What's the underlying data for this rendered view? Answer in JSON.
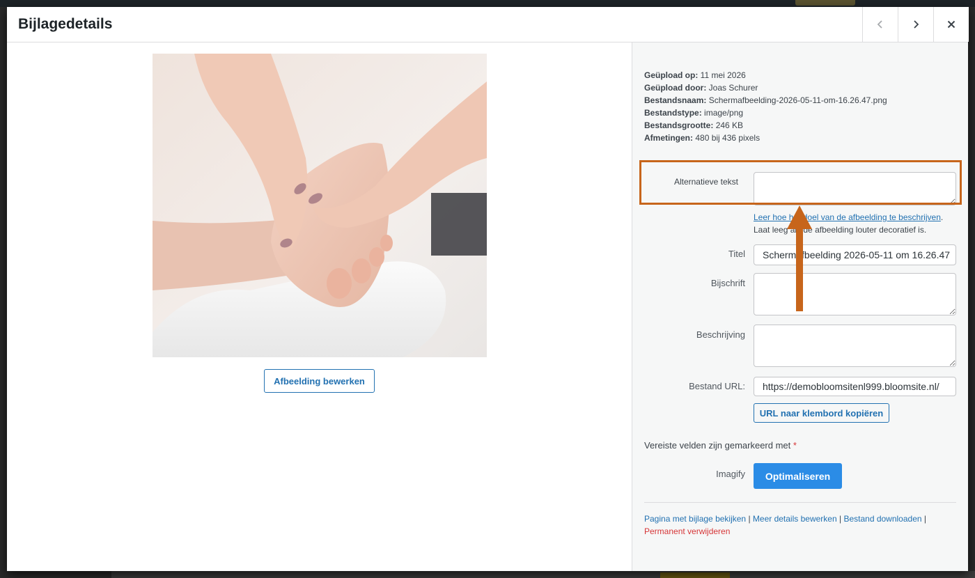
{
  "modal": {
    "title": "Bijlagedetails"
  },
  "image": {
    "alt": "Voetmassage"
  },
  "buttons": {
    "edit_image": "Afbeelding bewerken",
    "copy_url": "URL naar klembord kopiëren",
    "optimize": "Optimaliseren"
  },
  "file_info": {
    "uploaded_on_label": "Geüpload op:",
    "uploaded_on": "11 mei 2026",
    "uploaded_by_label": "Geüpload door:",
    "uploaded_by": "Joas Schurer",
    "filename_label": "Bestandsnaam:",
    "filename": "Schermafbeelding-2026-05-11-om-16.26.47.png",
    "filetype_label": "Bestandstype:",
    "filetype": "image/png",
    "filesize_label": "Bestandsgrootte:",
    "filesize": "246 KB",
    "dimensions_label": "Afmetingen:",
    "dimensions": "480 bij 436 pixels"
  },
  "fields": {
    "alt_label": "Alternatieve tekst",
    "alt_value": "",
    "alt_help_link": "Leer hoe het doel van de afbeelding te beschrijven",
    "alt_help_text": "Laat leeg als de afbeelding louter decoratief is.",
    "title_label": "Titel",
    "title_value": "Schermafbeelding 2026-05-11 om 16.26.47",
    "caption_label": "Bijschrift",
    "caption_value": "",
    "description_label": "Beschrijving",
    "description_value": "",
    "url_label": "Bestand URL:",
    "url_value": "https://demobloomsitenl999.bloomsite.nl/"
  },
  "required_note": {
    "text": "Vereiste velden zijn gemarkeerd met",
    "star": "*"
  },
  "imagify": {
    "label": "Imagify"
  },
  "actions": {
    "view": "Pagina met bijlage bekijken",
    "edit_more": "Meer details bewerken",
    "download": "Bestand downloaden",
    "separator": "|",
    "delete": "Permanent verwijderen"
  },
  "colors": {
    "link": "#2271b1",
    "danger": "#d63638",
    "annotation": "#c7651b",
    "optimize": "#2b8ce6"
  }
}
